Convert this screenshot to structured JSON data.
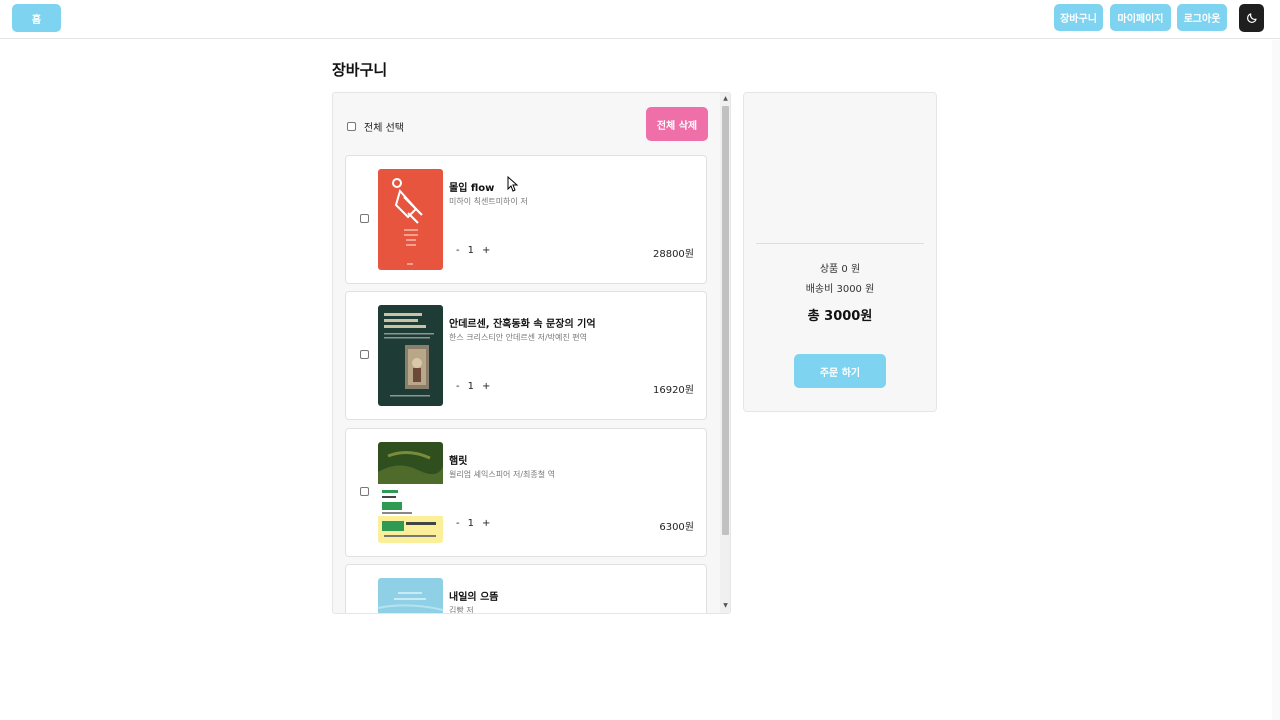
{
  "header": {
    "home_label": "홈",
    "cart_label": "장바구니",
    "mypage_label": "마이페이지",
    "logout_label": "로그아웃",
    "theme_icon": "moon-icon"
  },
  "page": {
    "title": "장바구니"
  },
  "cart": {
    "select_all_label": "전체 선택",
    "delete_all_label": "전체 삭제",
    "items": [
      {
        "title": "몰입 flow",
        "author": "미하이 칙센트미하이 저",
        "qty": "1",
        "price": "28800원",
        "cover_color": "#e8553f"
      },
      {
        "title": "안데르센, 잔혹동화 속 문장의 기억",
        "author": "한스 크리스티안 안데르센 저/박예진 편역",
        "qty": "1",
        "price": "16920원",
        "cover_color": "#1e3b36"
      },
      {
        "title": "햄릿",
        "author": "윌리엄 셰익스피어 저/최종철 역",
        "qty": "1",
        "price": "6300원",
        "cover_color": "#2f4f1f"
      },
      {
        "title": "내일의 으뜸",
        "author": "김빵 저",
        "qty": "",
        "price": "",
        "cover_color": "#8fd0e6"
      }
    ],
    "qty_minus": "-",
    "qty_plus": "+"
  },
  "summary": {
    "product_line": "상품 0 원",
    "shipping_line": "배송비 3000 원",
    "total_line": "총 3000원",
    "order_label": "주문 하기"
  },
  "colors": {
    "accent": "#7dd3f0",
    "danger": "#ef6fa8"
  }
}
